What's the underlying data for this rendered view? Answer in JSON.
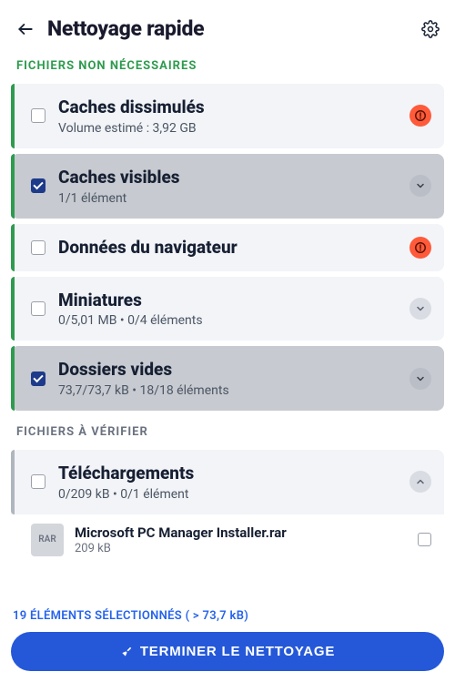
{
  "header": {
    "title": "Nettoyage rapide"
  },
  "sections": {
    "unneeded": {
      "title": "FICHIERS NON NÉCESSAIRES"
    },
    "verify": {
      "title": "FICHIERS À VÉRIFIER"
    }
  },
  "cards": {
    "hidden_caches": {
      "title": "Caches dissimulés",
      "sub": "Volume estimé : 3,92 GB"
    },
    "visible_caches": {
      "title": "Caches visibles",
      "sub": "1/1 élément"
    },
    "browser_data": {
      "title": "Données du navigateur"
    },
    "thumbnails": {
      "title": "Miniatures",
      "sub": "0/5,01 MB • 0/4 éléments"
    },
    "empty_folders": {
      "title": "Dossiers vides",
      "sub": "73,7/73,7 kB • 18/18 éléments"
    },
    "downloads": {
      "title": "Téléchargements",
      "sub": "0/209 kB • 0/1 élément"
    }
  },
  "files": {
    "rar": {
      "thumb": "RAR",
      "name": "Microsoft PC Manager Installer.rar",
      "size": "209 kB"
    }
  },
  "footer": {
    "summary": "19 ÉLÉMENTS SÉLECTIONNÉS ( > 73,7 kB)",
    "cta": "TERMINER LE NETTOYAGE"
  }
}
